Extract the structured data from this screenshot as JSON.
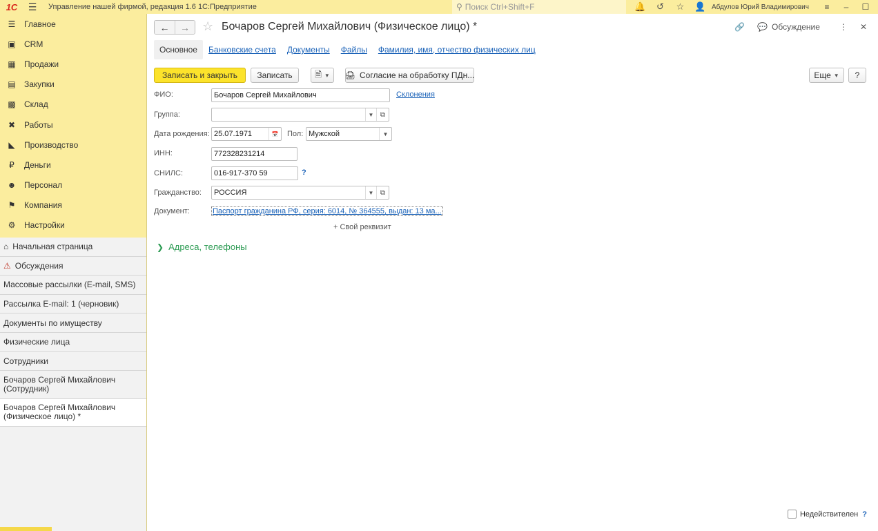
{
  "topbar": {
    "logo": "1С",
    "title": "Управление нашей фирмой, редакция 1.6 1С:Предприятие",
    "search_placeholder": "Поиск Ctrl+Shift+F",
    "user": "Абдулов Юрий Владимирович"
  },
  "sidebar": {
    "nav": [
      {
        "label": "Главное",
        "icon": "menu-icon"
      },
      {
        "label": "CRM",
        "icon": "crm-icon"
      },
      {
        "label": "Продажи",
        "icon": "sales-icon"
      },
      {
        "label": "Закупки",
        "icon": "purchases-icon"
      },
      {
        "label": "Склад",
        "icon": "warehouse-icon"
      },
      {
        "label": "Работы",
        "icon": "works-icon"
      },
      {
        "label": "Производство",
        "icon": "production-icon"
      },
      {
        "label": "Деньги",
        "icon": "money-icon"
      },
      {
        "label": "Персонал",
        "icon": "personnel-icon"
      },
      {
        "label": "Компания",
        "icon": "company-icon"
      },
      {
        "label": "Настройки",
        "icon": "settings-icon"
      }
    ],
    "open_windows": [
      "Начальная страница",
      "Обсуждения",
      "Массовые рассылки (E-mail, SMS)",
      "Рассылка E-mail: 1  (черновик)",
      "Документы по имуществу",
      "Физические лица",
      "Сотрудники",
      "Бочаров Сергей Михайлович",
      "(Сотрудник)",
      "Бочаров Сергей Михайлович",
      "(Физическое лицо) *"
    ]
  },
  "form": {
    "title": "Бочаров Сергей Михайлович (Физическое лицо) *",
    "discussion": "Обсуждение",
    "tabs": [
      "Основное",
      "Банковские счета",
      "Документы",
      "Файлы",
      "Фамилия, имя, отчество физических лиц"
    ],
    "toolbar": {
      "save_close": "Записать и закрыть",
      "save": "Записать",
      "consent": "Согласие на обработку ПДн...",
      "more": "Еще",
      "help": "?"
    },
    "fields": {
      "fio_label": "ФИО:",
      "fio_value": "Бочаров Сергей Михайлович",
      "declension_link": "Склонения",
      "group_label": "Группа:",
      "group_value": "",
      "birth_label": "Дата рождения:",
      "birth_value": "25.07.1971",
      "gender_label": "Пол:",
      "gender_value": "Мужской",
      "inn_label": "ИНН:",
      "inn_value": "772328231214",
      "snils_label": "СНИЛС:",
      "snils_value": "016-917-370 59",
      "citizenship_label": "Гражданство:",
      "citizenship_value": "РОССИЯ",
      "document_label": "Документ:",
      "document_value": "Паспорт гражданина РФ, серия: 6014, № 364555, выдан: 13 ма..."
    },
    "custom_attribute": "+ Свой реквизит",
    "group_addresses": "Адреса, телефоны",
    "inactive_label": "Недействителен",
    "inactive_help": "?"
  }
}
